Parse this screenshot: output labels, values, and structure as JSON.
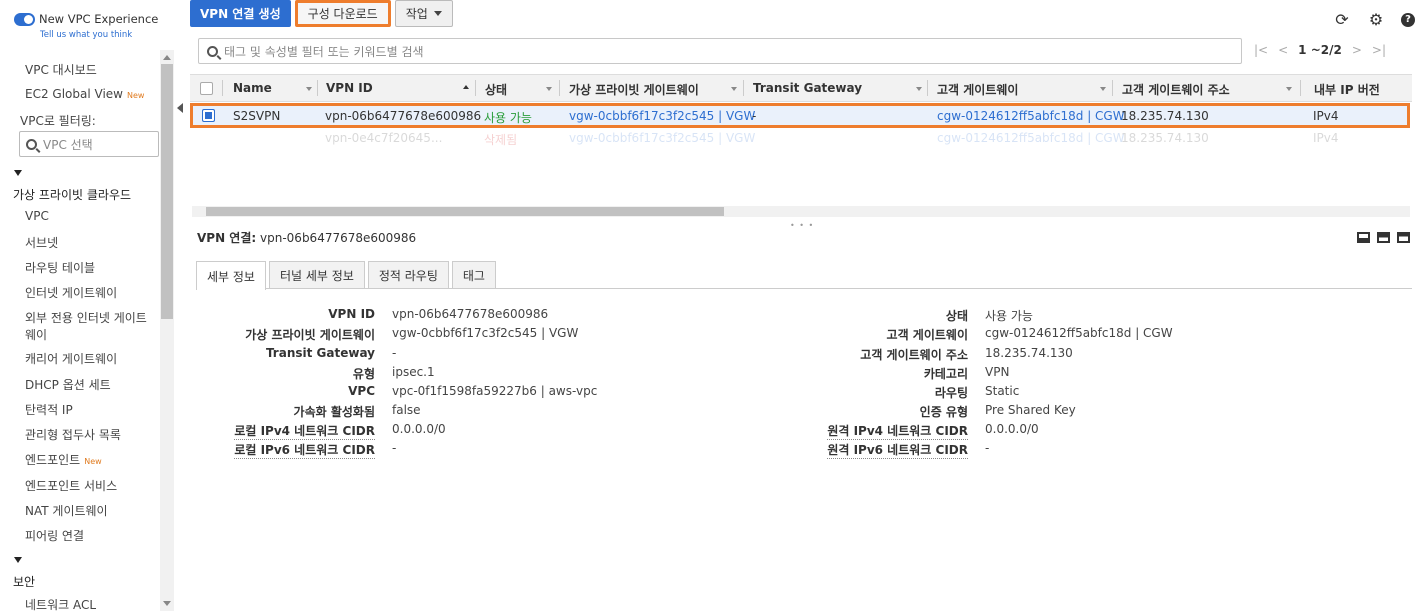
{
  "sidebar": {
    "toggle_label": "New VPC Experience",
    "feedback": "Tell us what you think",
    "filter_label": "VPC로 필터링:",
    "filter_placeholder": "VPC 선택",
    "new_badge": "New",
    "items_top": [
      "VPC 대시보드",
      "EC2 Global View"
    ],
    "section_vpc": "가상 프라이빗 클라우드",
    "items_vpc": [
      "VPC",
      "서브넷",
      "라우팅 테이블",
      "인터넷 게이트웨이",
      "외부 전용 인터넷 게이트",
      "웨이",
      "캐리어 게이트웨이",
      "DHCP 옵션 세트",
      "탄력적 IP",
      "관리형 접두사 목록",
      "엔드포인트",
      "엔드포인트 서비스",
      "NAT 게이트웨이",
      "피어링 연결"
    ],
    "section_security": "보안",
    "items_security": [
      "네트워크 ACL"
    ]
  },
  "toolbar": {
    "create_label": "VPN 연결 생성",
    "download_label": "구성 다운로드",
    "actions_label": "작업"
  },
  "search": {
    "placeholder": "태그 및 속성별 필터 또는 키워드별 검색"
  },
  "pager": {
    "count": "1 ~2/2"
  },
  "table": {
    "columns": [
      "Name",
      "VPN ID",
      "상태",
      "가상 프라이빗 게이트웨이",
      "Transit Gateway",
      "고객 게이트웨이",
      "고객 게이트웨이 주소",
      "내부 IP 버전"
    ],
    "selected_row": [
      "S2SVPN",
      "vpn-06b6477678e600986",
      "사용 가능",
      "vgw-0cbbf6f17c3f2c545 | VGW",
      "-",
      "cgw-0124612ff5abfc18d | CGW",
      "18.235.74.130",
      "IPv4"
    ],
    "ghost_row": [
      "",
      "vpn-0e4c7f20645...",
      "삭제됨",
      "vgw-0cbbf6f17c3f2c545 | VGW",
      "",
      "cgw-0124612ff5abfc18d | CGW",
      "18.235.74.130",
      "IPv4"
    ]
  },
  "details": {
    "title_label": "VPN 연결:",
    "title_value": "vpn-06b6477678e600986",
    "tabs": [
      "세부 정보",
      "터널 세부 정보",
      "정적 라우팅",
      "태그"
    ],
    "left": [
      {
        "label": "VPN ID",
        "value": "vpn-06b6477678e600986"
      },
      {
        "label": "가상 프라이빗 게이트웨이",
        "value": "vgw-0cbbf6f17c3f2c545 | VGW"
      },
      {
        "label": "Transit Gateway",
        "value": "-"
      },
      {
        "label": "유형",
        "value": "ipsec.1"
      },
      {
        "label": "VPC",
        "value": "vpc-0f1f1598fa59227b6 | aws-vpc"
      },
      {
        "label": "가속화 활성화됨",
        "value": "false"
      },
      {
        "label": "로컬 IPv4 네트워크 CIDR",
        "value": "0.0.0.0/0"
      },
      {
        "label": "로컬 IPv6 네트워크 CIDR",
        "value": "-"
      }
    ],
    "right": [
      {
        "label": "상태",
        "value": "사용 가능"
      },
      {
        "label": "고객 게이트웨이",
        "value": "cgw-0124612ff5abfc18d | CGW"
      },
      {
        "label": "고객 게이트웨이 주소",
        "value": "18.235.74.130"
      },
      {
        "label": "카테고리",
        "value": "VPN"
      },
      {
        "label": "라우팅",
        "value": "Static"
      },
      {
        "label": "인증 유형",
        "value": "Pre Shared Key"
      },
      {
        "label": "원격 IPv4 네트워크 CIDR",
        "value": "0.0.0.0/0"
      },
      {
        "label": "원격 IPv6 네트워크 CIDR",
        "value": "-"
      }
    ]
  },
  "colors": {
    "accent": "#2d6ed0",
    "highlight": "#ee7d2d",
    "status_green": "#2a9d3a"
  }
}
